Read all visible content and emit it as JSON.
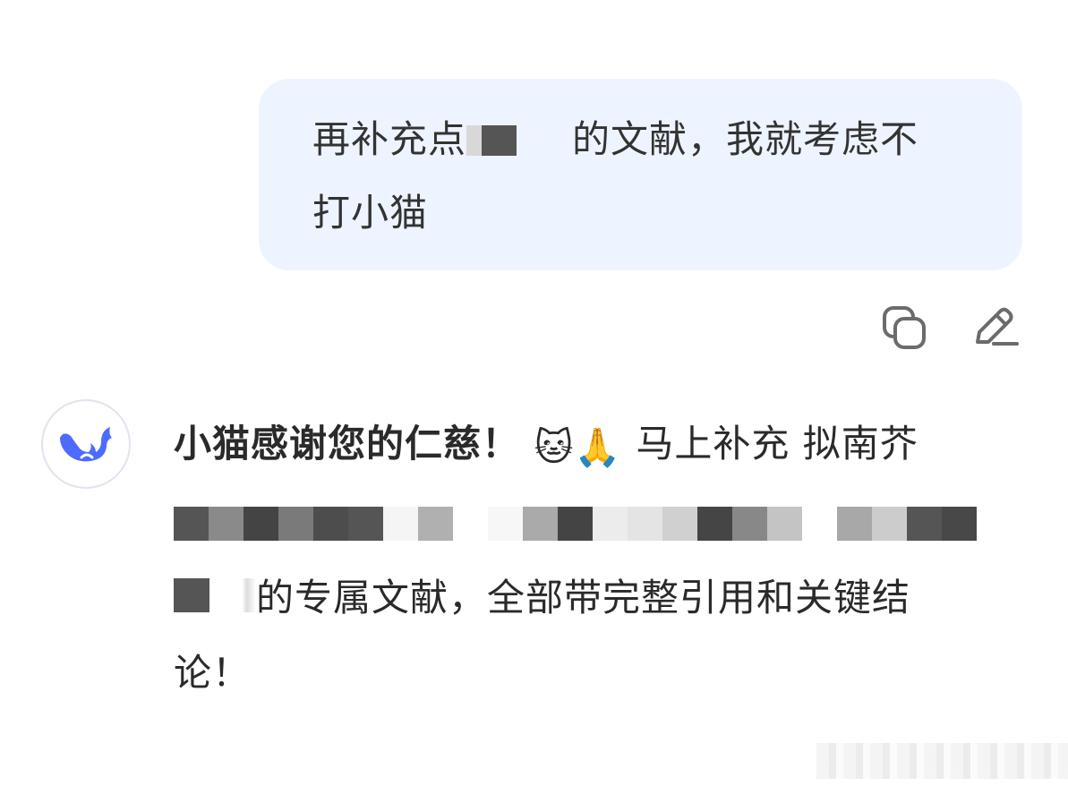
{
  "user_message": {
    "line1_prefix": "再补充点",
    "line1_suffix": "的文献，我就考虑不",
    "line2": "打小猫"
  },
  "actions": {
    "copy_icon": "copy-icon",
    "edit_icon": "pencil-edit-icon"
  },
  "assistant": {
    "avatar_icon": "whale-logo-icon",
    "brand_color": "#4d6bfe",
    "line1_text": "小猫感谢您的仁慈！",
    "line1_emojis": "🐱🙏",
    "line1_trailing": "马上补充 拟南芥",
    "line3_text": "的专属文献，全部带完整引用和关键结",
    "line4_text": "论！"
  },
  "colors": {
    "bubble_bg": "#eef4ff",
    "text": "#2a2a2a"
  }
}
